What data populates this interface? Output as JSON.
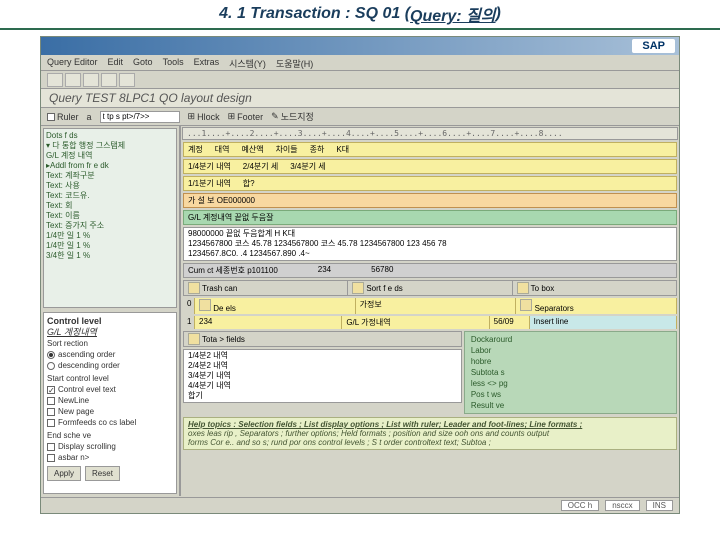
{
  "slide": {
    "title_prefix": "4. 1 Transaction : SQ 01 (",
    "title_query": "Query: 질의",
    "title_suffix": ")"
  },
  "titlebar": {
    "left": "",
    "sap": "SAP"
  },
  "menu": {
    "m1": "Query Editor",
    "m2": "Edit",
    "m3": "Goto",
    "m4": "Tools",
    "m5": "Extras",
    "m6": "시스템(Y)",
    "m7": "도움말(H)"
  },
  "query_title": "Query TEST 8LPC1 QO layout design",
  "toolbar2": {
    "ruler": "Ruler",
    "a": "a",
    "input": "t tp s pt>/7>>",
    "hlock": "Hlock",
    "footer": "Footer",
    "node": "노드지정"
  },
  "tree": {
    "hdr": "Dots f  ds",
    "lines": [
      "▾ 다 통합 행정 그스탬제",
      "  G/L 계정 내역",
      "  ▸Addl from  fr e dk",
      "    Text: 계좌구분",
      "    Text: 사용",
      "    Text: 코드유.",
      "    Text: 회",
      "    Text: 이름",
      "    Text: 증가지 주소",
      "    1/4만 일 1 %",
      "    1/4만 일 1 %",
      "    3/4한 일 1 %"
    ]
  },
  "control": {
    "hdr": "Control level",
    "sub": "G/L  계정내역",
    "sort_hdr": "Sort rection",
    "sort1": "ascending order",
    "sort2": "descending order",
    "start_hdr": "Start control level",
    "chk1": "Control evel text",
    "chk2": "NewLine",
    "chk3": "New page",
    "chk4": "Formfeeds co cs label",
    "end_hdr": "End sche  ve",
    "chk5": "Display scrolling",
    "chk6": "asbar  n>",
    "btn1": "Apply",
    "btn2": "Reset"
  },
  "layout": {
    "ruler1": "...1....+....2....+....3....+....4....+....5....+....6....+....7....+....8....",
    "header": {
      "c1": "계정",
      "c2": "대역",
      "c3": "예산액",
      "c4": "차이들",
      "c5": "종하",
      "c6": "K대"
    },
    "rows": {
      "r1": {
        "a": "1/4분기 내역",
        "b": "2/4분기 세",
        "c": "3/4분기 세"
      },
      "r2": {
        "a": "1/1분기 내역",
        "b": "합?"
      }
    },
    "peach": "가 설 보 OE000000",
    "green": "G/L 계정내역  끝없 두음잘",
    "data": {
      "l1": "98000000  끝없 두음합계                   H          K대",
      "l2": "1234567800 코스 45.78   1234567800 코스 45.78   1234567800 123 456 78",
      "l3": "1234567.8C0.  .4    1234567.890 .4~"
    },
    "gray": {
      "a": "Cum ct 세종번호 p101100",
      "b": "56780",
      "mid": "234"
    },
    "midtb": {
      "s1": "Trash can",
      "s2": "Sort f e ds",
      "s3": "To   box"
    },
    "content": {
      "left0": "0",
      "left1": "1",
      "details": "De els",
      "r1a": "가정보",
      "r1b": "234",
      "r1c": "G/L 가정내역",
      "r1d": "56/09",
      "sep": "Separators",
      "ins": "Insert line",
      "totals": "Tota >  fields"
    },
    "side": {
      "s1": "Dockarourd",
      "s2": "Labor",
      "s3": "hobre",
      "s4": "Subtota s",
      "s5": "less <>  pg",
      "s6": "Pos t ws",
      "s7": "Result  ve"
    },
    "wb": {
      "l1": "1/4분2 내역",
      "l2": "2/4분2 내역",
      "l3": "3/4분기 내역",
      "l4": "4/4분기 내역",
      "l5": "합기"
    }
  },
  "help": {
    "l1": "Help topics : Selection fields ; List display options ; List with ruler;   Leader and foot-lines; Line formats ;",
    "l2": "oxes   leas rip , Separators ; further options;  Held formats ; position and size   ooh ons and counts   output",
    "l3": "forms   Cor e..  and so s; rund por ons   control levels ; S t  order   controltext text; Subtoa ;"
  },
  "status": {
    "s1": "OCC  h",
    "s2": "nsccx",
    "s3": "INS"
  }
}
